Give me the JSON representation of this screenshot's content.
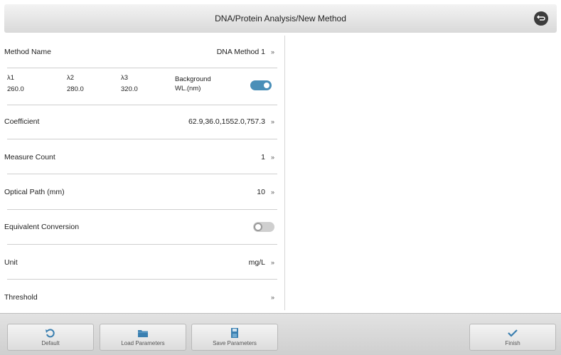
{
  "header": {
    "title": "DNA/Protein Analysis/New Method"
  },
  "method_name": {
    "label": "Method Name",
    "value": "DNA Method 1",
    "chevron": "»"
  },
  "wavelengths": {
    "cols": [
      {
        "label": "λ1",
        "value": "260.0"
      },
      {
        "label": "λ2",
        "value": "280.0"
      },
      {
        "label": "λ3",
        "value": "320.0"
      }
    ],
    "background_label_1": "Background",
    "background_label_2": "WL.(nm)",
    "background_toggle": "on"
  },
  "coefficient": {
    "label": "Coefficient",
    "value": "62.9,36.0,1552.0,757.3",
    "chevron": "»"
  },
  "measure_count": {
    "label": "Measure Count",
    "value": "1",
    "chevron": "»"
  },
  "optical_path": {
    "label": "Optical Path (mm)",
    "value": "10",
    "chevron": "»"
  },
  "equivalent_conversion": {
    "label": "Equivalent Conversion",
    "toggle": "off"
  },
  "unit": {
    "label": "Unit",
    "value": "mg/L",
    "chevron": "»"
  },
  "threshold": {
    "label": "Threshold",
    "chevron": "»"
  },
  "toolbar": {
    "default_label": "Default",
    "load_label": "Load Parameters",
    "save_label": "Save Parameters",
    "finish_label": "Finish"
  },
  "icons": {
    "back": "return-arrow-icon",
    "default": "reset-arrow-icon",
    "load": "folder-icon",
    "save": "save-disk-icon",
    "finish": "checkmark-icon"
  },
  "colors": {
    "accent": "#4a8fb8",
    "toolbar": "#d9d9d9"
  }
}
